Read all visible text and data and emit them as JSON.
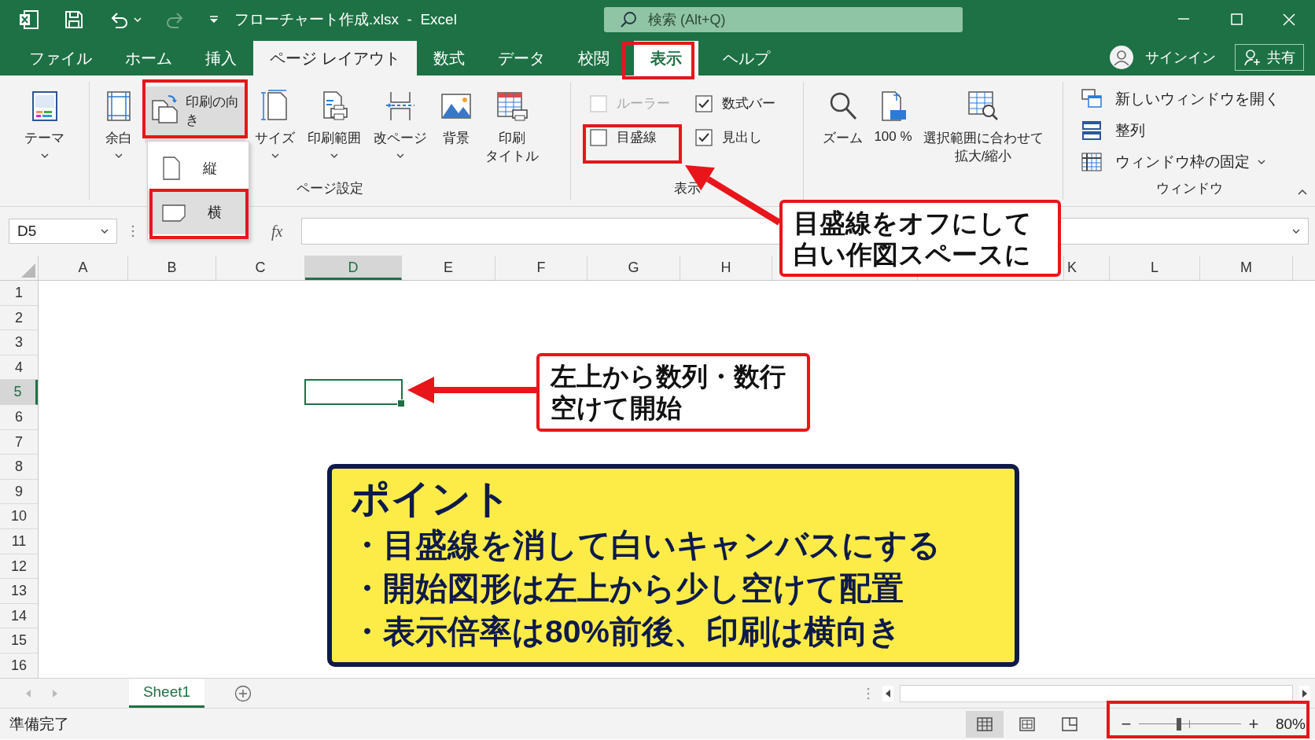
{
  "title_bar": {
    "title": "フローチャート作成.xlsx  -  Excel",
    "search_placeholder": "検索 (Alt+Q)"
  },
  "tabs": [
    {
      "label": "ファイル",
      "selected": false,
      "emphasized": false
    },
    {
      "label": "ホーム",
      "selected": false,
      "emphasized": false
    },
    {
      "label": "挿入",
      "selected": false,
      "emphasized": false
    },
    {
      "label": "ページ レイアウト",
      "selected": true,
      "emphasized": false
    },
    {
      "label": "数式",
      "selected": false,
      "emphasized": false
    },
    {
      "label": "データ",
      "selected": false,
      "emphasized": false
    },
    {
      "label": "校閲",
      "selected": false,
      "emphasized": false
    },
    {
      "label": "表示",
      "selected": false,
      "emphasized": true
    },
    {
      "label": "ヘルプ",
      "selected": false,
      "emphasized": false
    }
  ],
  "account": {
    "sign_in": "サインイン",
    "share": "共有"
  },
  "ribbon": {
    "groups": [
      {
        "items": [
          {
            "kind": "large",
            "label": "テーマ",
            "dropdown": true
          }
        ]
      },
      {
        "label": "ページ設定",
        "items": [
          {
            "kind": "large",
            "label": "余白",
            "dropdown": true
          },
          {
            "kind": "large",
            "lines": [
              "印刷の向",
              "き"
            ],
            "dropdown": false
          },
          {
            "kind": "large",
            "label": "サイズ",
            "dropdown": true
          },
          {
            "kind": "large",
            "label": "印刷範囲",
            "dropdown": true
          },
          {
            "kind": "large",
            "label": "改ページ",
            "dropdown": true
          },
          {
            "kind": "large",
            "label": "背景",
            "dropdown": false
          },
          {
            "kind": "large",
            "lines": [
              "印刷",
              "タイトル"
            ],
            "dropdown": false
          }
        ]
      },
      {
        "label": "表示",
        "items": [
          {
            "kind": "checkbox",
            "label": "ルーラー",
            "checked": false,
            "disabled": true
          },
          {
            "kind": "checkbox",
            "label": "数式バー",
            "checked": true,
            "disabled": false
          },
          {
            "kind": "checkbox",
            "label": "目盛線",
            "checked": false,
            "disabled": false
          },
          {
            "kind": "checkbox",
            "label": "見出し",
            "checked": true,
            "disabled": false
          }
        ]
      },
      {
        "items": [
          {
            "kind": "large",
            "label": "ズーム",
            "dropdown": false
          },
          {
            "kind": "large",
            "label": "100 %",
            "dropdown": false
          },
          {
            "kind": "large",
            "lines": [
              "選択範囲に合わせて",
              "拡大/縮小"
            ],
            "dropdown": false
          }
        ]
      },
      {
        "label": "ウィンドウ",
        "items": [
          {
            "kind": "small",
            "label": "新しいウィンドウを開く",
            "dropdown": false
          },
          {
            "kind": "small",
            "label": "整列",
            "dropdown": false
          },
          {
            "kind": "small",
            "label": "ウィンドウ枠の固定",
            "dropdown": true
          }
        ]
      }
    ]
  },
  "orientation_menu": [
    {
      "label": "縦",
      "selected": false
    },
    {
      "label": "横",
      "selected": true
    }
  ],
  "formula_bar": {
    "name_box": "D5",
    "function_label": "fx"
  },
  "columns": [
    {
      "label": "A",
      "selected": false
    },
    {
      "label": "B",
      "selected": false
    },
    {
      "label": "C",
      "selected": false
    },
    {
      "label": "D",
      "selected": true
    },
    {
      "label": "E",
      "selected": false
    },
    {
      "label": "F",
      "selected": false
    },
    {
      "label": "G",
      "selected": false
    },
    {
      "label": "H",
      "selected": false
    },
    {
      "label": "K",
      "selected": false
    },
    {
      "label": "L",
      "selected": false
    },
    {
      "label": "M",
      "selected": false
    }
  ],
  "rows": [
    {
      "label": "1",
      "selected": false
    },
    {
      "label": "2",
      "selected": false
    },
    {
      "label": "3",
      "selected": false
    },
    {
      "label": "4",
      "selected": false
    },
    {
      "label": "5",
      "selected": true
    },
    {
      "label": "6",
      "selected": false
    },
    {
      "label": "7",
      "selected": false
    },
    {
      "label": "8",
      "selected": false
    },
    {
      "label": "9",
      "selected": false
    },
    {
      "label": "10",
      "selected": false
    },
    {
      "label": "11",
      "selected": false
    },
    {
      "label": "12",
      "selected": false
    },
    {
      "label": "13",
      "selected": false
    },
    {
      "label": "14",
      "selected": false
    },
    {
      "label": "15",
      "selected": false
    },
    {
      "label": "16",
      "selected": false
    }
  ],
  "sheet_tabs": [
    {
      "label": "Sheet1",
      "selected": true
    }
  ],
  "status_bar": {
    "status": "準備完了",
    "views": [
      {
        "selected": true
      },
      {
        "selected": false
      },
      {
        "selected": false
      }
    ],
    "zoom": {
      "minus": "−",
      "plus": "+",
      "level": 0.39,
      "reading": "80%"
    }
  },
  "annotations": {
    "callouts": [
      {
        "lines": [
          "目盛線をオフにして",
          "白い作図スペースに"
        ]
      },
      {
        "lines": [
          "左上から数列・数行",
          "空けて開始"
        ]
      }
    ],
    "tip": {
      "title": "ポイント",
      "bullets": [
        "・目盛線を消して白いキャンバスにする",
        "・開始図形は左上から少し空けて配置",
        "・表示倍率は80%前後、印刷は横向き"
      ]
    }
  }
}
